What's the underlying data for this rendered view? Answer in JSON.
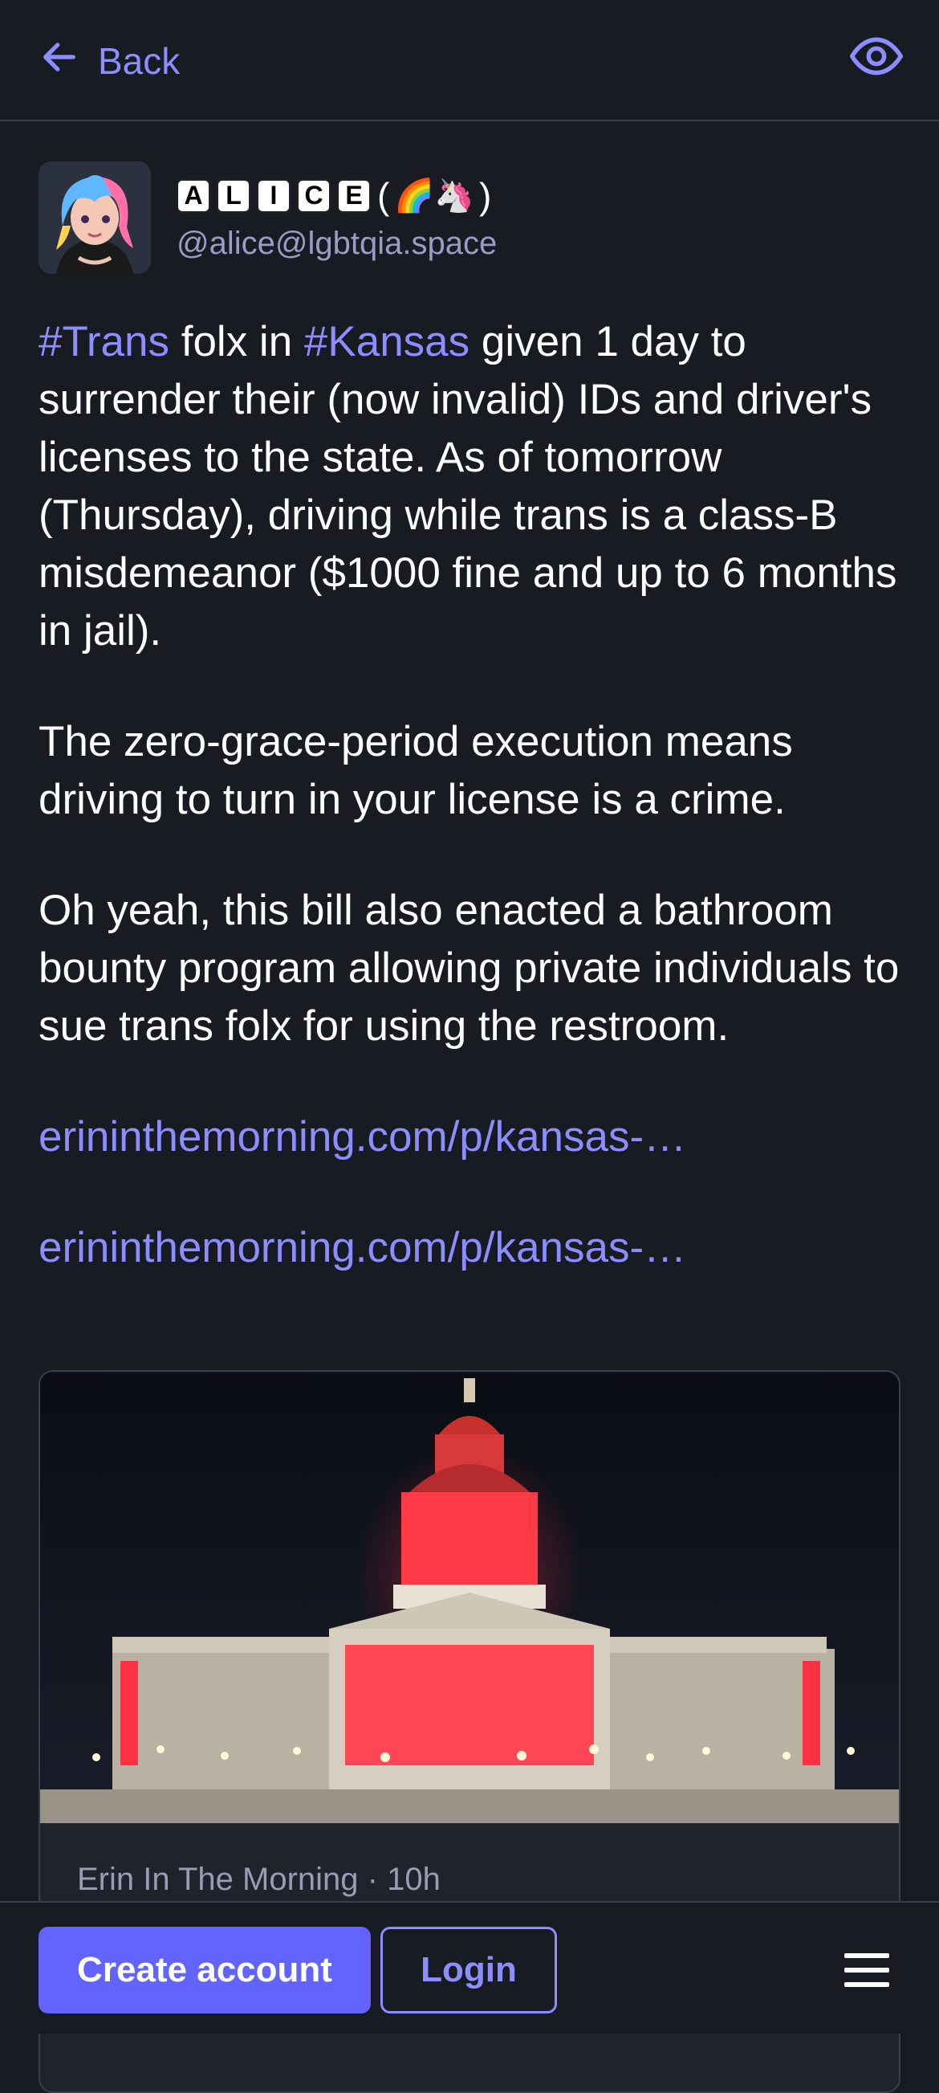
{
  "header": {
    "back_label": "Back",
    "back_icon": "arrow-left-icon",
    "visibility_icon": "eye-icon"
  },
  "status": {
    "account": {
      "display_name_letters": [
        "A",
        "L",
        "I",
        "C",
        "E"
      ],
      "display_name_suffix_open": "(",
      "display_name_emoji": "🌈🦄",
      "display_name_suffix_close": ")",
      "handle": "@alice@lgbtqia.space"
    },
    "paragraph1": {
      "tag1": "#Trans",
      "text1": " folx in ",
      "tag2": "#Kansas",
      "text2": " given 1 day to surrender their (now invalid) IDs and driver's licenses to the state. As of tomorrow (Thursday), driving while trans is a class-B misdemeanor ($1000 fine and up to 6 months in jail)."
    },
    "paragraph2": "The zero-grace-period execution means driving to turn in your license is a crime.",
    "paragraph3": "Oh yeah, this bill also enacted a bathroom bounty program allowing private individuals to sue trans folx for using the restroom.",
    "links": [
      "erininthemorning.com/p/kansas-…",
      "erininthemorning.com/p/kansas-…"
    ],
    "card": {
      "meta": "Erin In The Morning · 10h"
    }
  },
  "footer": {
    "create_account_label": "Create account",
    "login_label": "Login",
    "menu_icon": "hamburger-menu-icon"
  },
  "colors": {
    "background": "#191b22",
    "accent": "#8c8dff",
    "primary_button": "#6364ff",
    "divider": "#393f4f"
  }
}
